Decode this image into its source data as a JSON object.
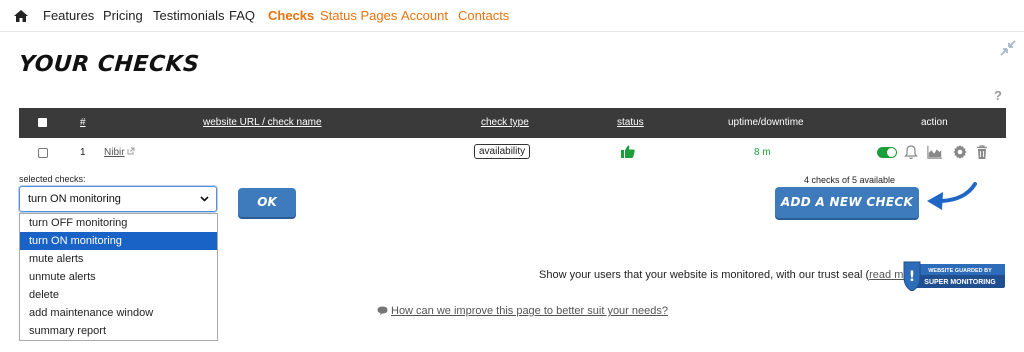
{
  "nav": {
    "items": [
      {
        "label": "Features"
      },
      {
        "label": "Pricing"
      },
      {
        "label": "Testimonials"
      },
      {
        "label": "FAQ"
      },
      {
        "label": "Checks"
      },
      {
        "label": "Status Pages"
      },
      {
        "label": "Account"
      },
      {
        "label": "Contacts"
      }
    ],
    "active": "Checks",
    "accent_color": "#e8730c"
  },
  "page": {
    "title": "YOUR CHECKS",
    "help": "?"
  },
  "table": {
    "headers": {
      "num": "#",
      "url": "website URL / check name",
      "type": "check type",
      "status": "status",
      "uptime": "uptime/downtime",
      "action": "action"
    },
    "rows": [
      {
        "num": "1",
        "name": "Nibir",
        "type": "availability",
        "status_icon": "thumbs-up-icon",
        "uptime": "8 m",
        "monitoring_on": true
      }
    ]
  },
  "bulk": {
    "label": "selected checks:",
    "selected": "turn ON monitoring",
    "options": [
      "turn OFF monitoring",
      "turn ON monitoring",
      "mute alerts",
      "unmute alerts",
      "delete",
      "add maintenance window",
      "summary report"
    ],
    "ok_label": "OK"
  },
  "quota": {
    "text": "4 checks of 5 available",
    "add_label": "ADD A NEW CHECK"
  },
  "trust": {
    "text": "Show your users that your website is monitored, with our trust seal (",
    "link": "read more",
    "suffix": "):",
    "seal_top": "WEBSITE GUARDED BY",
    "seal_bottom": "SUPER MONITORING"
  },
  "feedback": {
    "link": "How can we improve this page to better suit your needs?"
  },
  "colors": {
    "button_blue": "#3d7bbd",
    "header_dark": "#3a3a3a",
    "success_green": "#1a9e3a",
    "select_blue": "#1a63c6"
  }
}
